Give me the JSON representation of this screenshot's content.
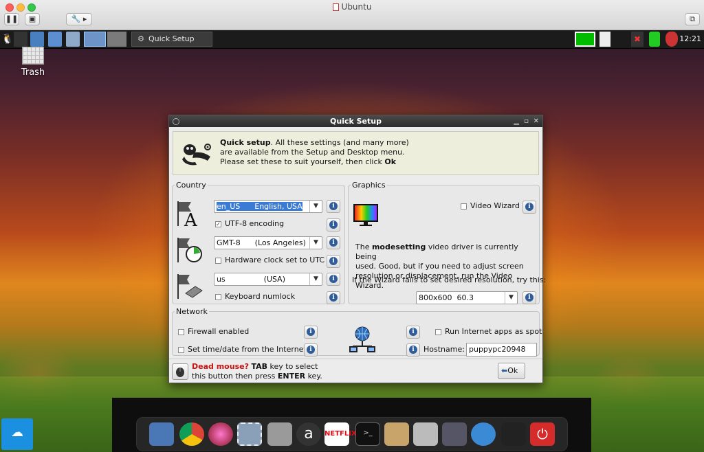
{
  "host_window": {
    "title": "Ubuntu"
  },
  "panel": {
    "task_label": "Quick Setup",
    "clock": "12:21"
  },
  "desktop": {
    "trash_label": "Trash"
  },
  "dialog": {
    "title": "Quick Setup",
    "intro": {
      "bold": "Quick setup",
      "line1": ". All these settings (and many more)",
      "line2": "are available from the Setup and Desktop menu.",
      "line3_pre": "Please set these to suit yourself, then click ",
      "line3_bold": "Ok"
    },
    "country": {
      "legend": "Country",
      "locale_value": "en_US      English, USA",
      "utf8_label": "UTF-8 encoding",
      "utf8_checked": true,
      "timezone_value": "GMT-8      (Los Angeles)",
      "hwclock_label": "Hardware clock set to UTC",
      "hwclock_checked": false,
      "keyboard_value": "us                (USA)",
      "numlock_label": "Keyboard numlock",
      "numlock_checked": false
    },
    "graphics": {
      "legend": "Graphics",
      "video_wizard_label": "Video Wizard",
      "video_wizard_checked": false,
      "desc_pre": "The ",
      "desc_bold": "modesetting",
      "desc_line1_post": " video driver is currently being",
      "desc_line2": "used. Good, but if you need to adjust screen",
      "desc_line3": "resolution or displacement, run the Video Wizard.",
      "fallback_text": "If the Wizard fails to set desired resolution, try this:",
      "resolution_value": "800x600  60.3"
    },
    "network": {
      "legend": "Network",
      "firewall_label": "Firewall enabled",
      "firewall_checked": false,
      "timedate_label": "Set time/date from the Internet",
      "timedate_checked": false,
      "spot_label": "Run Internet apps as spot",
      "spot_checked": false,
      "hostname_label": "Hostname:",
      "hostname_value": "puppypc20948"
    },
    "footer": {
      "dead_mouse": "Dead mouse?",
      "tab": "TAB",
      "line1_post": " key to select",
      "line2_pre": "this button then press ",
      "enter": "ENTER",
      "line2_post": " key.",
      "ok_label": "Ok"
    }
  },
  "dock": {
    "netflix_label": "NETFLIX"
  },
  "colors": {
    "accent": "#3a7bd5",
    "danger": "#cc1111",
    "power": "#d62b2b"
  }
}
